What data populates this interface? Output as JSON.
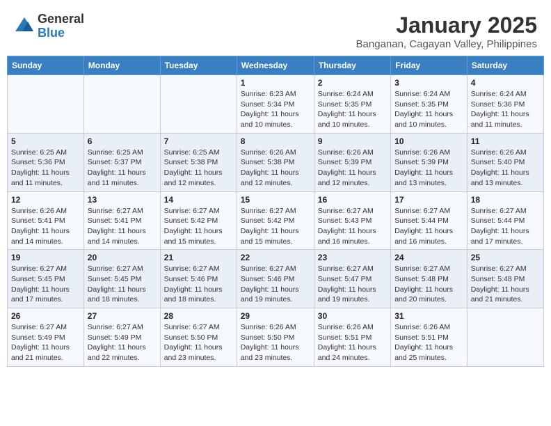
{
  "header": {
    "logo_general": "General",
    "logo_blue": "Blue",
    "month_title": "January 2025",
    "subtitle": "Banganan, Cagayan Valley, Philippines"
  },
  "days_of_week": [
    "Sunday",
    "Monday",
    "Tuesday",
    "Wednesday",
    "Thursday",
    "Friday",
    "Saturday"
  ],
  "weeks": [
    [
      {
        "day": "",
        "info": ""
      },
      {
        "day": "",
        "info": ""
      },
      {
        "day": "",
        "info": ""
      },
      {
        "day": "1",
        "info": "Sunrise: 6:23 AM\nSunset: 5:34 PM\nDaylight: 11 hours and 10 minutes."
      },
      {
        "day": "2",
        "info": "Sunrise: 6:24 AM\nSunset: 5:35 PM\nDaylight: 11 hours and 10 minutes."
      },
      {
        "day": "3",
        "info": "Sunrise: 6:24 AM\nSunset: 5:35 PM\nDaylight: 11 hours and 10 minutes."
      },
      {
        "day": "4",
        "info": "Sunrise: 6:24 AM\nSunset: 5:36 PM\nDaylight: 11 hours and 11 minutes."
      }
    ],
    [
      {
        "day": "5",
        "info": "Sunrise: 6:25 AM\nSunset: 5:36 PM\nDaylight: 11 hours and 11 minutes."
      },
      {
        "day": "6",
        "info": "Sunrise: 6:25 AM\nSunset: 5:37 PM\nDaylight: 11 hours and 11 minutes."
      },
      {
        "day": "7",
        "info": "Sunrise: 6:25 AM\nSunset: 5:38 PM\nDaylight: 11 hours and 12 minutes."
      },
      {
        "day": "8",
        "info": "Sunrise: 6:26 AM\nSunset: 5:38 PM\nDaylight: 11 hours and 12 minutes."
      },
      {
        "day": "9",
        "info": "Sunrise: 6:26 AM\nSunset: 5:39 PM\nDaylight: 11 hours and 12 minutes."
      },
      {
        "day": "10",
        "info": "Sunrise: 6:26 AM\nSunset: 5:39 PM\nDaylight: 11 hours and 13 minutes."
      },
      {
        "day": "11",
        "info": "Sunrise: 6:26 AM\nSunset: 5:40 PM\nDaylight: 11 hours and 13 minutes."
      }
    ],
    [
      {
        "day": "12",
        "info": "Sunrise: 6:26 AM\nSunset: 5:41 PM\nDaylight: 11 hours and 14 minutes."
      },
      {
        "day": "13",
        "info": "Sunrise: 6:27 AM\nSunset: 5:41 PM\nDaylight: 11 hours and 14 minutes."
      },
      {
        "day": "14",
        "info": "Sunrise: 6:27 AM\nSunset: 5:42 PM\nDaylight: 11 hours and 15 minutes."
      },
      {
        "day": "15",
        "info": "Sunrise: 6:27 AM\nSunset: 5:42 PM\nDaylight: 11 hours and 15 minutes."
      },
      {
        "day": "16",
        "info": "Sunrise: 6:27 AM\nSunset: 5:43 PM\nDaylight: 11 hours and 16 minutes."
      },
      {
        "day": "17",
        "info": "Sunrise: 6:27 AM\nSunset: 5:44 PM\nDaylight: 11 hours and 16 minutes."
      },
      {
        "day": "18",
        "info": "Sunrise: 6:27 AM\nSunset: 5:44 PM\nDaylight: 11 hours and 17 minutes."
      }
    ],
    [
      {
        "day": "19",
        "info": "Sunrise: 6:27 AM\nSunset: 5:45 PM\nDaylight: 11 hours and 17 minutes."
      },
      {
        "day": "20",
        "info": "Sunrise: 6:27 AM\nSunset: 5:45 PM\nDaylight: 11 hours and 18 minutes."
      },
      {
        "day": "21",
        "info": "Sunrise: 6:27 AM\nSunset: 5:46 PM\nDaylight: 11 hours and 18 minutes."
      },
      {
        "day": "22",
        "info": "Sunrise: 6:27 AM\nSunset: 5:46 PM\nDaylight: 11 hours and 19 minutes."
      },
      {
        "day": "23",
        "info": "Sunrise: 6:27 AM\nSunset: 5:47 PM\nDaylight: 11 hours and 19 minutes."
      },
      {
        "day": "24",
        "info": "Sunrise: 6:27 AM\nSunset: 5:48 PM\nDaylight: 11 hours and 20 minutes."
      },
      {
        "day": "25",
        "info": "Sunrise: 6:27 AM\nSunset: 5:48 PM\nDaylight: 11 hours and 21 minutes."
      }
    ],
    [
      {
        "day": "26",
        "info": "Sunrise: 6:27 AM\nSunset: 5:49 PM\nDaylight: 11 hours and 21 minutes."
      },
      {
        "day": "27",
        "info": "Sunrise: 6:27 AM\nSunset: 5:49 PM\nDaylight: 11 hours and 22 minutes."
      },
      {
        "day": "28",
        "info": "Sunrise: 6:27 AM\nSunset: 5:50 PM\nDaylight: 11 hours and 23 minutes."
      },
      {
        "day": "29",
        "info": "Sunrise: 6:26 AM\nSunset: 5:50 PM\nDaylight: 11 hours and 23 minutes."
      },
      {
        "day": "30",
        "info": "Sunrise: 6:26 AM\nSunset: 5:51 PM\nDaylight: 11 hours and 24 minutes."
      },
      {
        "day": "31",
        "info": "Sunrise: 6:26 AM\nSunset: 5:51 PM\nDaylight: 11 hours and 25 minutes."
      },
      {
        "day": "",
        "info": ""
      }
    ]
  ]
}
